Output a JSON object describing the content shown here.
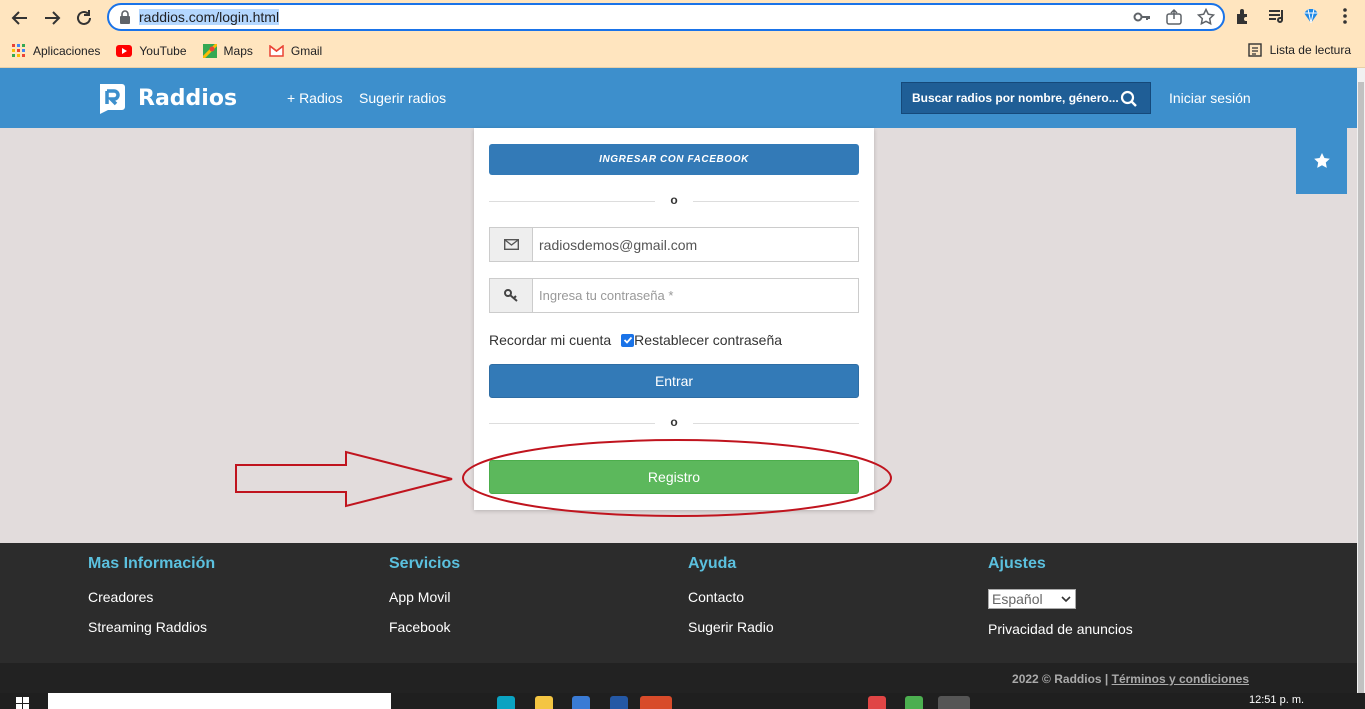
{
  "browser": {
    "url_host": "raddios.com",
    "url_path": "/login.html",
    "bookmarks": [
      {
        "label": "Aplicaciones",
        "icon": "apps-grid-icon"
      },
      {
        "label": "YouTube",
        "icon": "youtube-icon"
      },
      {
        "label": "Maps",
        "icon": "maps-icon"
      },
      {
        "label": "Gmail",
        "icon": "gmail-icon"
      }
    ],
    "reading_list": "Lista de lectura"
  },
  "header": {
    "logo_text": "Raddios",
    "nav": [
      "+ Radios",
      "Sugerir radios"
    ],
    "search_placeholder": "Buscar radios por nombre, género...",
    "login": "Iniciar sesión"
  },
  "login": {
    "facebook_button": "INGRESAR CON FACEBOOK",
    "or_text": "o",
    "email_value": "radiosdemos@gmail.com",
    "password_placeholder": "Ingresa tu contraseña *",
    "remember": "Recordar mi cuenta",
    "reset": "Restablecer contraseña",
    "enter_button": "Entrar",
    "register_button": "Registro"
  },
  "footer": {
    "columns": [
      {
        "title": "Mas Información",
        "links": [
          "Creadores",
          "Streaming Raddios"
        ]
      },
      {
        "title": "Servicios",
        "links": [
          "App Movil",
          "Facebook"
        ]
      },
      {
        "title": "Ayuda",
        "links": [
          "Contacto",
          "Sugerir Radio"
        ]
      },
      {
        "title": "Ajustes",
        "select_value": "Español",
        "links": [
          "Privacidad de anuncios"
        ]
      }
    ],
    "copyright": "2022 © Raddios",
    "separator": "|",
    "terms": "Términos y condiciones"
  },
  "taskbar": {
    "time": "12:51 p. m."
  },
  "colors": {
    "header_blue": "#3d8fcc",
    "facebook_blue": "#337ab7",
    "register_green": "#5cb85c",
    "footer_heading": "#5bc0de",
    "annotation_red": "#c0141e"
  }
}
